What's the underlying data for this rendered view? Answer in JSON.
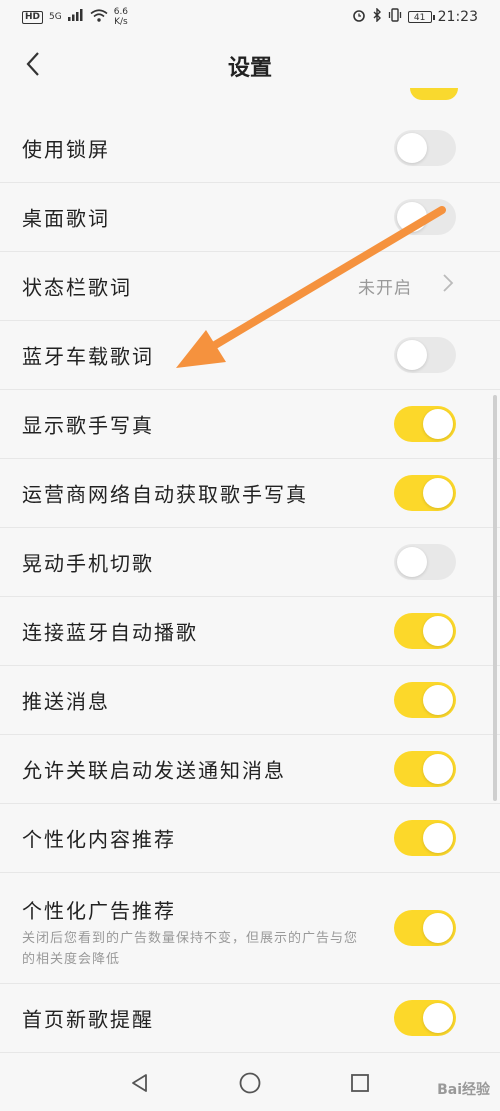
{
  "status": {
    "hd": "HD",
    "network": "5G",
    "speed_value": "6.6",
    "speed_unit": "K/s",
    "battery": "41",
    "time": "21:23"
  },
  "header": {
    "title": "设置"
  },
  "settings": [
    {
      "label": "使用锁屏",
      "toggle": "off"
    },
    {
      "label": "桌面歌词",
      "toggle": "off"
    },
    {
      "label": "状态栏歌词",
      "value": "未开启"
    },
    {
      "label": "蓝牙车载歌词",
      "toggle": "off"
    },
    {
      "label": "显示歌手写真",
      "toggle": "on"
    },
    {
      "label": "运营商网络自动获取歌手写真",
      "toggle": "on"
    },
    {
      "label": "晃动手机切歌",
      "toggle": "off"
    },
    {
      "label": "连接蓝牙自动播歌",
      "toggle": "on"
    },
    {
      "label": "推送消息",
      "toggle": "on"
    },
    {
      "label": "允许关联启动发送通知消息",
      "toggle": "on"
    },
    {
      "label": "个性化内容推荐",
      "toggle": "on"
    },
    {
      "label": "个性化广告推荐",
      "description": "关闭后您看到的广告数量保持不变，但展示的广告与您的相关度会降低",
      "toggle": "on"
    },
    {
      "label": "首页新歌提醒",
      "toggle": "on"
    }
  ],
  "watermark": "Bai经验",
  "colors": {
    "accent": "#fcd82a",
    "annotation_arrow": "#f5923e"
  }
}
